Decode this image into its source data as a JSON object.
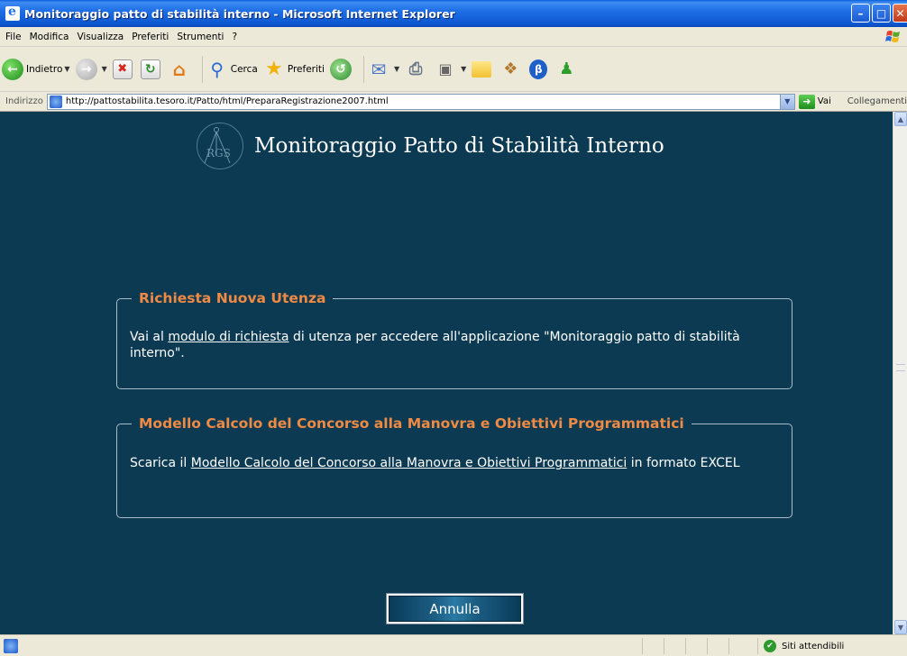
{
  "window": {
    "title": "Monitoraggio patto di stabilità interno - Microsoft Internet Explorer"
  },
  "menu": [
    "File",
    "Modifica",
    "Visualizza",
    "Preferiti",
    "Strumenti",
    "?"
  ],
  "toolbar": {
    "back_label": "Indietro",
    "search_label": "Cerca",
    "favorites_label": "Preferiti"
  },
  "address": {
    "label": "Indirizzo",
    "url": "http://pattostabilita.tesoro.it/Patto/html/PreparaRegistrazione2007.html",
    "go_label": "Vai",
    "links_label": "Collegamenti"
  },
  "page": {
    "logo_text": "RGS",
    "title": "Monitoraggio Patto di Stabilità Interno",
    "box1": {
      "legend": "Richiesta Nuova Utenza",
      "text_before": "Vai al ",
      "link": "modulo di richiesta",
      "text_after": " di utenza per accedere all'applicazione \"Monitoraggio patto di stabilità interno\"."
    },
    "box2": {
      "legend": "Modello Calcolo del Concorso alla Manovra e Obiettivi Programmatici",
      "text_before": "Scarica il ",
      "link": "Modello Calcolo del Concorso alla Manovra e Obiettivi Programmatici",
      "text_after": " in formato EXCEL"
    },
    "cancel_label": "Annulla"
  },
  "status": {
    "zone": "Siti attendibili"
  }
}
